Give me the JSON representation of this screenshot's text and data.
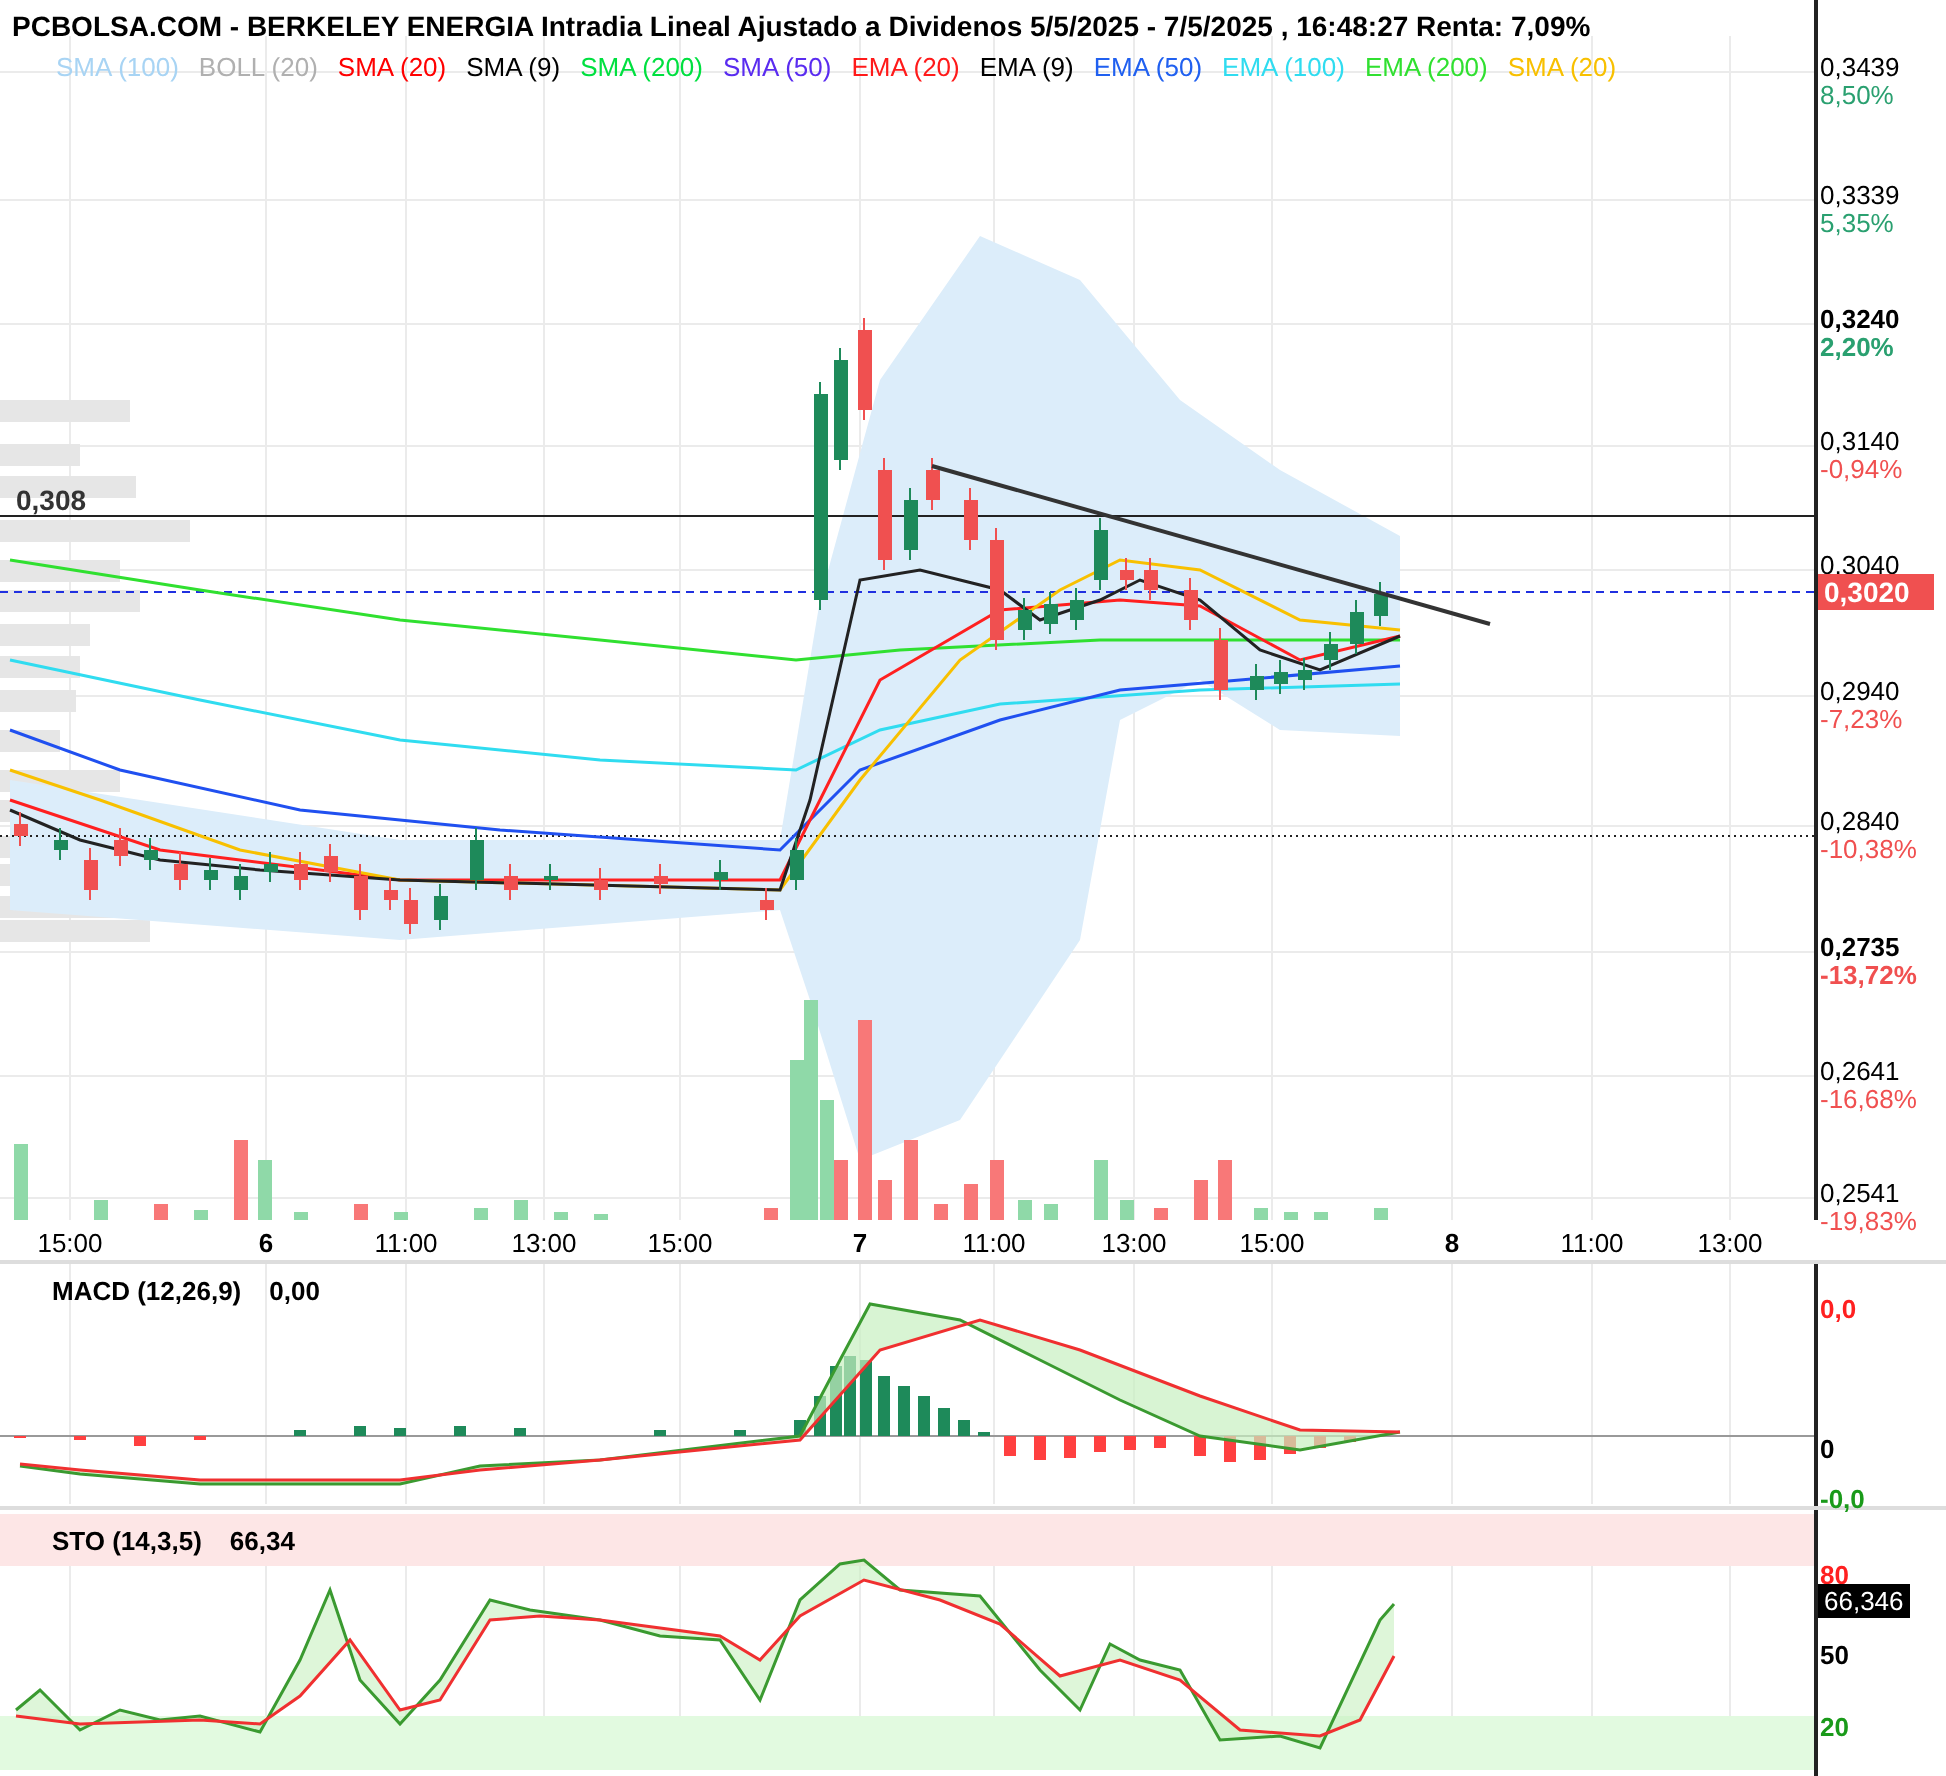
{
  "title": "PCBOLSA.COM - BERKELEY ENERGIA Intradia Lineal Ajustado a Dividenos 5/5/2025 - 7/5/2025 , 16:48:27 Renta: 7,09%",
  "legend": [
    {
      "label": "SMA (100)",
      "color": "#a8d4f4"
    },
    {
      "label": "BOLL (20)",
      "color": "#b0b0b0"
    },
    {
      "label": "SMA (20)",
      "color": "#ff0000"
    },
    {
      "label": "SMA (9)",
      "color": "#000000"
    },
    {
      "label": "SMA (200)",
      "color": "#00e040"
    },
    {
      "label": "SMA (50)",
      "color": "#5a2cf0"
    },
    {
      "label": "EMA (20)",
      "color": "#ff1a1a"
    },
    {
      "label": "EMA (9)",
      "color": "#000000"
    },
    {
      "label": "EMA (50)",
      "color": "#2060f0"
    },
    {
      "label": "EMA (100)",
      "color": "#30dcf0"
    },
    {
      "label": "EMA (200)",
      "color": "#30e030"
    },
    {
      "label": "SMA (20)",
      "color": "#f8c000"
    }
  ],
  "reference_label": "0,308",
  "price_axis": [
    {
      "price": "0,3439",
      "change": "8,50%",
      "gain": true,
      "bold": false
    },
    {
      "price": "0,3339",
      "change": "5,35%",
      "gain": true,
      "bold": false
    },
    {
      "price": "0,3240",
      "change": "2,20%",
      "gain": true,
      "bold": true
    },
    {
      "price": "0,3140",
      "change": "-0,94%",
      "gain": false,
      "bold": false
    },
    {
      "price": "0,3040",
      "bold": false
    },
    {
      "price": "0,2940",
      "change": "-7,23%",
      "gain": false,
      "bold": false
    },
    {
      "price": "0,2840",
      "change": "-10,38%",
      "gain": false,
      "bold": false
    },
    {
      "price": "0,2735",
      "change": "-13,72%",
      "gain": false,
      "bold": true
    },
    {
      "price": "0,2641",
      "change": "-16,68%",
      "gain": false,
      "bold": false
    },
    {
      "price": "0,2541",
      "change": "-19,83%",
      "gain": false,
      "bold": false
    }
  ],
  "current_price": "0,3020",
  "time_axis": [
    {
      "label": "15:00",
      "bold": false
    },
    {
      "label": "6",
      "bold": true
    },
    {
      "label": "11:00",
      "bold": false
    },
    {
      "label": "13:00",
      "bold": false
    },
    {
      "label": "15:00",
      "bold": false
    },
    {
      "label": "7",
      "bold": true
    },
    {
      "label": "11:00",
      "bold": false
    },
    {
      "label": "13:00",
      "bold": false
    },
    {
      "label": "15:00",
      "bold": false
    },
    {
      "label": "8",
      "bold": true
    },
    {
      "label": "11:00",
      "bold": false
    },
    {
      "label": "13:00",
      "bold": false
    }
  ],
  "macd": {
    "label": "MACD (12,26,9)",
    "value": "0,00",
    "axis": [
      {
        "label": "0,0",
        "color": "#ff2020"
      },
      {
        "label": "0",
        "color": "#000000"
      },
      {
        "label": "-0,0",
        "color": "#1a9a1a"
      }
    ]
  },
  "sto": {
    "label": "STO (14,3,5)",
    "value": "66,34",
    "current": "66,346",
    "axis": [
      {
        "label": "80",
        "color": "#ff2020"
      },
      {
        "label": "50",
        "color": "#000000"
      },
      {
        "label": "20",
        "color": "#1a9a1a"
      }
    ]
  }
}
